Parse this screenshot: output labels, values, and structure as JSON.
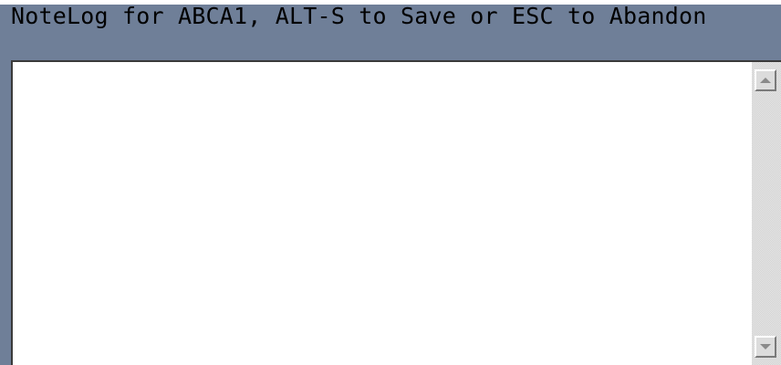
{
  "window": {
    "title": "NoteLog for ABCA1, ALT-S to Save or ESC to Abandon",
    "background_color": "#6f7f98"
  },
  "note": {
    "value": ""
  },
  "scrollbar": {
    "up_icon": "chevron-up-icon",
    "down_icon": "chevron-down-icon"
  }
}
